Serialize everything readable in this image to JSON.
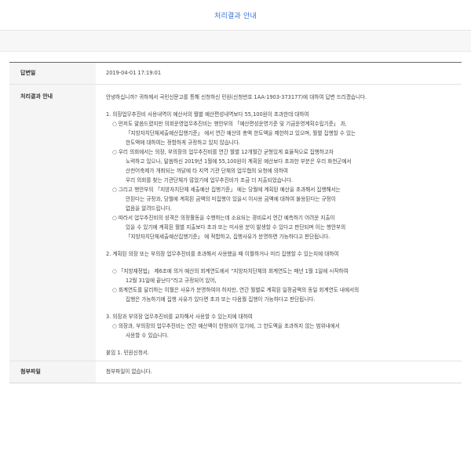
{
  "page": {
    "title": "처리결과 안내"
  },
  "table": {
    "date_label": "답변일",
    "date_value": "2019-04-01 17:19:01",
    "content_label": "처리결과 안내",
    "attach_label": "첨부파일",
    "attach_value": "첨부파일이 없습니다."
  },
  "content": {
    "blocks": [
      {
        "lines": [
          {
            "text": "안녕하십니까? 귀하께서 국민신문고를 통해 신청하신 민원(신청번호 1AA-1903-373177)에 대하여 답변 드리겠습니다.",
            "indent": 0
          }
        ]
      },
      {
        "lines": [
          {
            "text": "1. 의장업무추진비 사용내역이 예산서의 월별 예산편성내역보다 55,100원이 초과한데 대하여",
            "indent": 0
          },
          {
            "text": "○ 먼저도 말씀드렸지만 의회운영업무추진비는 행안부의 「예산편성운영기준 및 기금운영계획수립기준」 과,",
            "indent": 1
          },
          {
            "text": "「지방자치단체세출예산집행기준」 에서 연간 예산의 총액 한도액을 제한하고 있으며, 월별 집행할 수 있는",
            "indent": 2
          },
          {
            "text": "한도액에 대하여는 정함하게 규정하고 있지 않습니다.",
            "indent": 2
          },
          {
            "text": "○ 우리 의회에서는 의장, 부의장의 업무추진비를 연간 월별 12개월간 균형있게 효율적으로 집행하고자",
            "indent": 1
          },
          {
            "text": "노력하고 있으나, 말씀하신 2019년 1월에 55,100원이 계획된 예산보다 초과한 부분은 우리 화천군에서",
            "indent": 2
          },
          {
            "text": "산천어축제가 개최되는 까닭에 타 지역 기관 단체의 업무협의 요청에 의하여",
            "indent": 2
          },
          {
            "text": "우리 의회를 찾는 기관단체가 많았기에 업무추진비가 조금 더 지출되었습니다.",
            "indent": 2
          },
          {
            "text": "○ 그리고 행안부의 「지방자치단체 세출예산 집행기준」 에는 당월에 계획된 예산을 초과해서 집행해서는",
            "indent": 1
          },
          {
            "text": "안된다는 규정과, 당월에 계획된 금액의 미집행이 있을시 이사용 금액에 대하여 불용된다는 규정이",
            "indent": 2
          },
          {
            "text": "없음을 알려드립니다.",
            "indent": 2
          },
          {
            "text": "○ 따라서 업무추진비의 성격은 의정활동을 수행하는데 소요되는 경비로서 연간 예측하기 어려운 지출이",
            "indent": 1
          },
          {
            "text": "있을 수 있기에 계획된 월별 지출보다 초과 또는 미사용 분이 발생할 수 있다고 판단되며 이는 행안부의",
            "indent": 2
          },
          {
            "text": "「지방자치단체세출예산집행기준」 에 적합하고, 집행사유가 분명하면 가능하다고 판단됩니다.",
            "indent": 2
          }
        ]
      },
      {
        "lines": [
          {
            "text": "2. 계획된 의장 또는 부의장 업무추진비를 초과해서 사용했을 때 이월하거나 미리 집행할 수 있는지에 대하여",
            "indent": 0
          }
        ]
      },
      {
        "lines": [
          {
            "text": "○ 「지방재정법」 제6조에 의거 예산의 회계연도에서 “지방자치단체의 회계연도는 매년 1월 1일에 시작하여",
            "indent": 1
          },
          {
            "text": "12월 31일에 끝난다”라고 규정되어 있어,",
            "indent": 2
          },
          {
            "text": "○ 회계연도를 달리하는 이월은 사유가 분명하여야 하지만, 연간 월별로 계획된 일정금액의 동일 회계연도 내에서의",
            "indent": 1
          },
          {
            "text": "집행은 가능하기에 집행 사유가 있다면 초과 또는 다음월 집행이 가능하다고 판단됩니다.",
            "indent": 2
          }
        ]
      },
      {
        "lines": [
          {
            "text": "3. 의장과 부의장 업무추진비를 교차해서 사용할 수 있는지에 대하여",
            "indent": 0
          },
          {
            "text": "○ 의장과, 부의장의 업무추진비는 연간 예산액이 한정되어 있기에, 그 한도액을 초과하지 않는 범위내에서",
            "indent": 1
          },
          {
            "text": "사용할 수 있습니다.",
            "indent": 2
          }
        ]
      },
      {
        "lines": [
          {
            "text": "붙임  1. 민원신청서.",
            "indent": 0
          }
        ]
      }
    ]
  }
}
